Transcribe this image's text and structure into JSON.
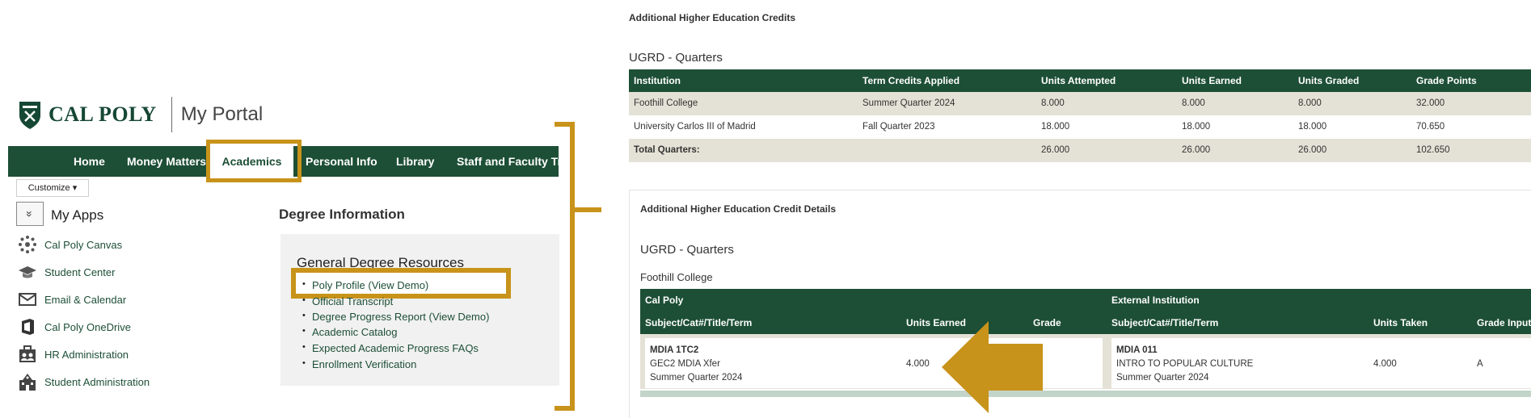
{
  "portal": {
    "brand": "CAL POLY",
    "title": "My Portal",
    "nav": [
      "Home",
      "Money Matters",
      "Academics",
      "Personal Info",
      "Library",
      "Staff and Faculty Trai"
    ],
    "customize_label": "Customize ▾",
    "collapse_glyph": "»",
    "my_apps_title": "My Apps",
    "apps": [
      {
        "label": "Cal Poly Canvas",
        "icon": "canvas-icon"
      },
      {
        "label": "Student Center",
        "icon": "graduation-cap-icon"
      },
      {
        "label": "Email & Calendar",
        "icon": "envelope-icon"
      },
      {
        "label": "Cal Poly OneDrive",
        "icon": "onedrive-icon"
      },
      {
        "label": "HR Administration",
        "icon": "hr-icon"
      },
      {
        "label": "Student Administration",
        "icon": "building-icon"
      }
    ],
    "degree_title": "Degree Information",
    "resources_title": "General Degree Resources",
    "resources": [
      "Poly Profile (View Demo)",
      "Official Transcript",
      "Degree Progress Report (View Demo)",
      "Academic Catalog",
      "Expected Academic Progress FAQs",
      "Enrollment Verification"
    ],
    "bullet": "•"
  },
  "credits": {
    "title": "Additional Higher Education Credits",
    "section": "UGRD - Quarters",
    "headers": [
      "Institution",
      "Term Credits Applied",
      "Units Attempted",
      "Units Earned",
      "Units Graded",
      "Grade Points"
    ],
    "rows": [
      [
        "Foothill College",
        "Summer Quarter 2024",
        "8.000",
        "8.000",
        "8.000",
        "32.000"
      ],
      [
        "University Carlos III of Madrid",
        "Fall Quarter 2023",
        "18.000",
        "18.000",
        "18.000",
        "70.650"
      ],
      [
        "Total Quarters:",
        "",
        "26.000",
        "26.000",
        "26.000",
        "102.650"
      ]
    ]
  },
  "details": {
    "title": "Additional Higher Education Credit Details",
    "section": "UGRD - Quarters",
    "institution": "Foothill College",
    "group_left": "Cal Poly",
    "group_right": "External Institution",
    "headers_left": [
      "Subject/Cat#/Title/Term",
      "Units Earned",
      "Grade"
    ],
    "headers_right": [
      "Subject/Cat#/Title/Term",
      "Units Taken",
      "Grade Input"
    ],
    "left_course": {
      "code": "MDIA 1TC2",
      "title": "GEC2 MDIA Xfer",
      "term": "Summer Quarter 2024",
      "units": "4.000",
      "grade": ""
    },
    "right_course": {
      "code": "MDIA 011",
      "title": "INTRO TO POPULAR CULTURE",
      "term": "Summer Quarter 2024",
      "units": "4.000",
      "grade": "A"
    }
  },
  "colors": {
    "brand_green": "#1d4f36",
    "highlight_gold": "#c8931a",
    "row_beige": "#e4e2d6"
  }
}
